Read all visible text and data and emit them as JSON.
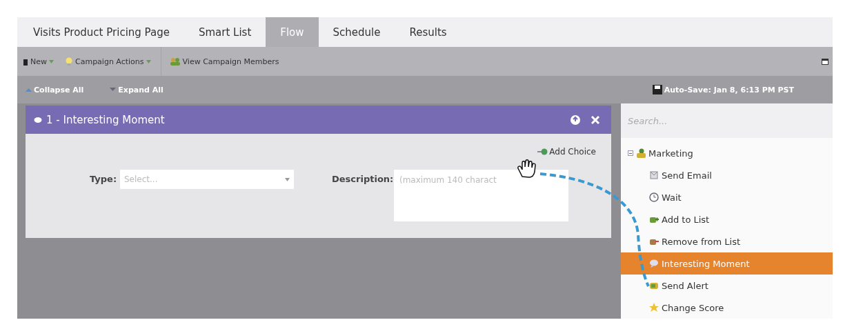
{
  "tabs": [
    {
      "label": "Visits Product Pricing Page",
      "selected": false
    },
    {
      "label": "Smart List",
      "selected": false
    },
    {
      "label": "Flow",
      "selected": true
    },
    {
      "label": "Schedule",
      "selected": false
    },
    {
      "label": "Results",
      "selected": false
    }
  ],
  "toolbar": {
    "buttons": [
      {
        "label": "New",
        "kind": "menu"
      },
      {
        "label": "Campaign Actions",
        "kind": "menu"
      },
      {
        "label": "View Campaign Members",
        "kind": "plain"
      }
    ]
  },
  "subbar": {
    "collapse": "Collapse All",
    "expand": "Expand All",
    "autosave": "Auto-Save: Jan 8, 6:13 PM PST"
  },
  "step": {
    "title": "1 - Interesting Moment",
    "add_choice": "Add Choice",
    "type_label": "Type:",
    "type_placeholder": "Select...",
    "description_label": "Description:",
    "description_placeholder": "(maximum 140 charact"
  },
  "palette": {
    "search_placeholder": "Search...",
    "tree": [
      {
        "label": "Marketing",
        "expanded": true,
        "children": [
          {
            "label": "Send Email",
            "selected": false
          },
          {
            "label": "Wait",
            "selected": false
          },
          {
            "label": "Add to List",
            "selected": false
          },
          {
            "label": "Remove from List",
            "selected": false
          },
          {
            "label": "Interesting Moment",
            "selected": true
          },
          {
            "label": "Send Alert",
            "selected": false
          },
          {
            "label": "Change Score",
            "selected": false
          }
        ]
      }
    ]
  }
}
